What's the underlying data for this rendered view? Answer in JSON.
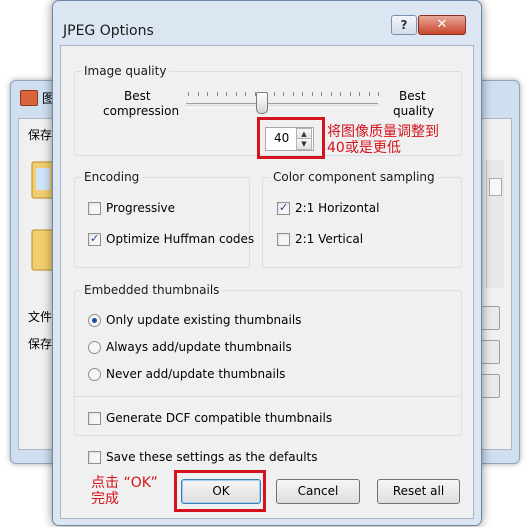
{
  "background_window": {
    "title": "图",
    "label_save_top": "保存",
    "label_file": "文件",
    "label_save_bottom": "保存"
  },
  "dialog": {
    "title": "JPEG Options",
    "help_glyph": "?",
    "close_glyph": "✕",
    "image_quality": {
      "group_label": "Image quality",
      "left_label_1": "Best",
      "left_label_2": "compression",
      "right_label_1": "Best",
      "right_label_2": "quality",
      "slider_value": 40,
      "spinner_value": "40",
      "spin_up": "▲",
      "spin_down": "▼"
    },
    "encoding": {
      "group_label": "Encoding",
      "progressive": {
        "label": "Progressive",
        "checked": false
      },
      "optimize_huffman": {
        "label": "Optimize Huffman codes",
        "checked": true
      }
    },
    "sampling": {
      "group_label": "Color component sampling",
      "horizontal": {
        "label": "2:1 Horizontal",
        "checked": true
      },
      "vertical": {
        "label": "2:1 Vertical",
        "checked": false
      }
    },
    "thumbnails": {
      "group_label": "Embedded thumbnails",
      "options": [
        {
          "label": "Only update existing thumbnails",
          "selected": true
        },
        {
          "label": "Always add/update thumbnails",
          "selected": false
        },
        {
          "label": "Never add/update thumbnails",
          "selected": false
        }
      ],
      "dcf": {
        "label": "Generate DCF compatible thumbnails",
        "checked": false
      }
    },
    "save_defaults": {
      "label": "Save these settings as the defaults",
      "checked": false
    },
    "buttons": {
      "ok": "OK",
      "cancel": "Cancel",
      "reset": "Reset all"
    },
    "check_glyph": "✓"
  },
  "annotations": {
    "quality_note_line1": "将图像质量调整到",
    "quality_note_line2": "40或是更低",
    "ok_note_line1": "点击 “OK”",
    "ok_note_line2": "完成",
    "color": "#d4131c"
  }
}
